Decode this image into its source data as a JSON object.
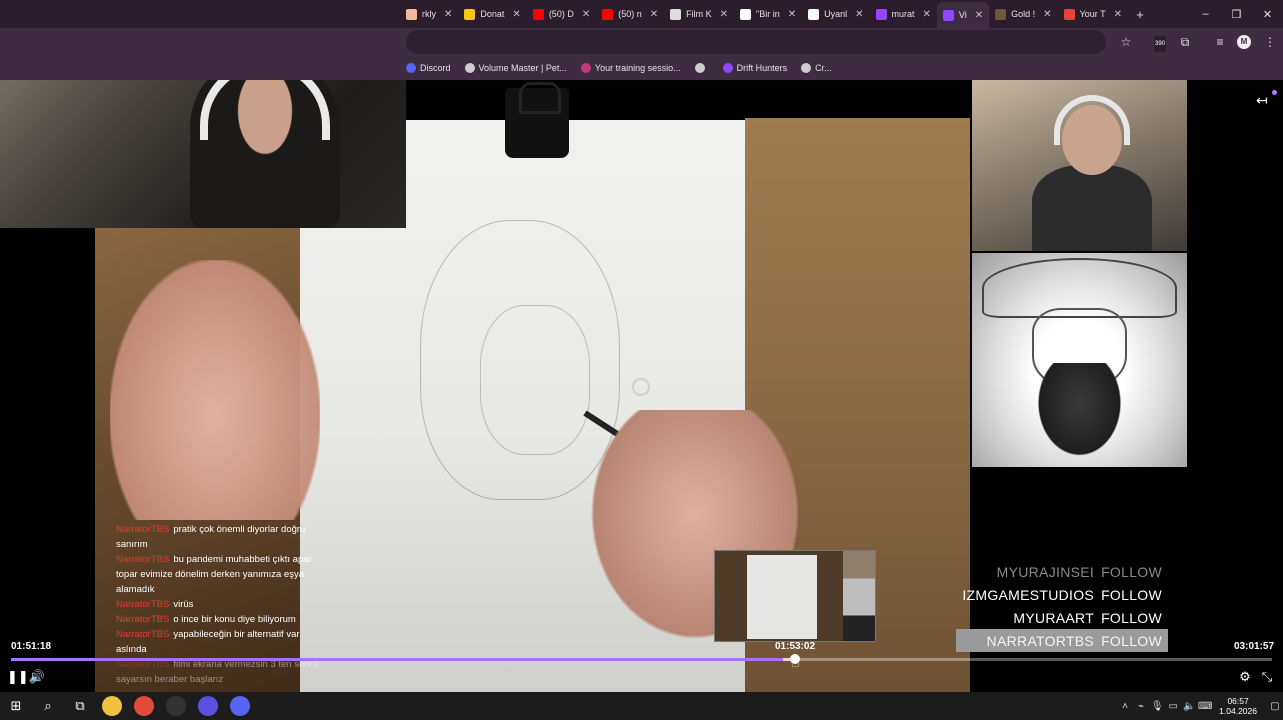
{
  "browser": {
    "tabs": [
      {
        "label": "rkly",
        "icon": "tab-icon",
        "color": "#f2b8a0"
      },
      {
        "label": "Donat",
        "icon": "donation-icon",
        "color": "#f5c518"
      },
      {
        "label": "(50) D",
        "icon": "youtube-icon",
        "color": "#ff0000"
      },
      {
        "label": "(50) n",
        "icon": "youtube-icon",
        "color": "#ff0000"
      },
      {
        "label": "Film K",
        "icon": "film-icon",
        "color": "#dddddd"
      },
      {
        "label": "\"Bir in",
        "icon": "google-icon",
        "color": "#ffffff"
      },
      {
        "label": "Uyanl",
        "icon": "diamond-icon",
        "color": "#ffffff"
      },
      {
        "label": "murat",
        "icon": "twitch-icon",
        "color": "#9146ff"
      },
      {
        "label": "Vi",
        "icon": "twitch-icon",
        "color": "#9146ff",
        "active": true
      },
      {
        "label": "Gold !",
        "icon": "gold-icon",
        "color": "#6a5a3a"
      },
      {
        "label": "Your T",
        "icon": "gmail-icon",
        "color": "#ea4335"
      }
    ],
    "new_tab": "+",
    "window_controls": {
      "minimize": "–",
      "restore": "❐",
      "close": "✕"
    },
    "extension_badge": "390",
    "profile_initial": "M",
    "bookmarks": [
      {
        "label": "Discord",
        "icon": "discord-icon",
        "color": "#5865f2"
      },
      {
        "label": "Volume Master | Pet...",
        "icon": "volume-icon",
        "color": "#cccccc"
      },
      {
        "label": "Your training sessio...",
        "icon": "training-icon",
        "color": "#c33b7a"
      },
      {
        "label": "",
        "icon": "globe-icon",
        "color": "#cccccc"
      },
      {
        "label": "Drift Hunters",
        "icon": "twitch-icon",
        "color": "#9146ff"
      },
      {
        "label": "Cr...",
        "icon": "star-icon",
        "color": "#cccccc"
      }
    ]
  },
  "chat": [
    {
      "user": "NarratorTBS",
      "text": "pratik çok önemli diyorlar doğru sanırım"
    },
    {
      "user": "NarratorTBS",
      "text": "bu pandemi muhabbeti çıktı apar topar evimize dönelim derken yanımıza eşya alamadık"
    },
    {
      "user": "NarratorTBS",
      "text": "virüs"
    },
    {
      "user": "NarratorTBS",
      "text": "o ince bir konu diye biliyorum"
    },
    {
      "user": "NarratorTBS",
      "text": "yapabileceğin bir alternatif var aslında"
    },
    {
      "user": "NarratorTBS",
      "text": "filmi ekrana vermezsin 3 ten sonra sayarsın beraber başlarız"
    }
  ],
  "follows": [
    {
      "name": "MYURAJINSEI",
      "action": "FOLLOW",
      "style": "dim"
    },
    {
      "name": "IZMGAMESTUDIOS",
      "action": "FOLLOW",
      "style": "normal"
    },
    {
      "name": "MYURAART",
      "action": "FOLLOW",
      "style": "normal"
    },
    {
      "name": "NARRATORTBS",
      "action": "FOLLOW",
      "style": "hl"
    }
  ],
  "player": {
    "current_time": "01:51:18",
    "hover_time": "01:53:02",
    "total_time": "03:01:57",
    "progress_fraction": 0.612,
    "hover_fraction": 0.622,
    "accent": "#a970ff"
  },
  "taskbar": {
    "apps": [
      {
        "icon": "windows-start-icon"
      },
      {
        "icon": "search-icon"
      },
      {
        "icon": "task-view-icon"
      },
      {
        "icon": "file-explorer-icon",
        "color": "#f0c040"
      },
      {
        "icon": "chrome-icon",
        "color": "#e04b3a"
      },
      {
        "icon": "obs-icon",
        "color": "#333333"
      },
      {
        "icon": "cortana-icon",
        "color": "#5b4fe0"
      },
      {
        "icon": "discord-app-icon",
        "color": "#5865f2"
      }
    ],
    "clock_time": "06:57",
    "clock_date": "1.04.2026"
  }
}
